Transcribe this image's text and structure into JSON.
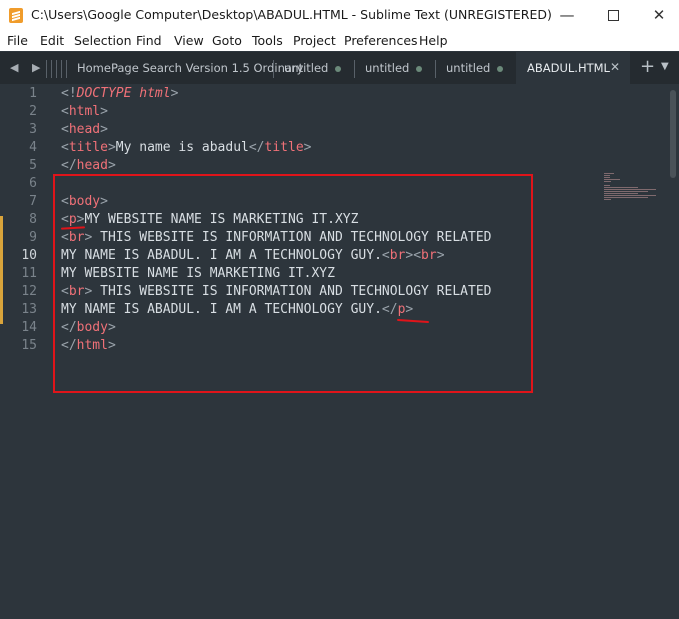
{
  "window": {
    "title": "C:\\Users\\Google Computer\\Desktop\\ABADUL.HTML - Sublime Text (UNREGISTERED)",
    "min_glyph": "—",
    "close_glyph": "✕"
  },
  "menu": [
    "File",
    "Edit",
    "Selection",
    "Find",
    "View",
    "Goto",
    "Tools",
    "Project",
    "Preferences",
    "Help"
  ],
  "tabs": {
    "nav_glyph": "◀ ▶",
    "items": [
      {
        "label": "HomePage Search Version 1.5 Ordinary"
      },
      {
        "label": "untitled"
      },
      {
        "label": "untitled"
      },
      {
        "label": "untitled"
      },
      {
        "label": "ABADUL.HTML",
        "active": true
      }
    ],
    "close_glyph": "✕",
    "plus_glyph": "+",
    "down_glyph": "▼"
  },
  "editor": {
    "active_line": 10,
    "lines": [
      {
        "n": "1",
        "tokens": [
          {
            "t": "punc",
            "v": "<!"
          },
          {
            "t": "doctype",
            "v": "DOCTYPE"
          },
          {
            "t": "text",
            "v": " "
          },
          {
            "t": "doctype",
            "v": "html"
          },
          {
            "t": "punc",
            "v": ">"
          }
        ]
      },
      {
        "n": "2",
        "tokens": [
          {
            "t": "punc",
            "v": "<"
          },
          {
            "t": "tag",
            "v": "html"
          },
          {
            "t": "punc",
            "v": ">"
          }
        ]
      },
      {
        "n": "3",
        "tokens": [
          {
            "t": "punc",
            "v": "<"
          },
          {
            "t": "tag",
            "v": "head"
          },
          {
            "t": "punc",
            "v": ">"
          }
        ]
      },
      {
        "n": "4",
        "tokens": [
          {
            "t": "punc",
            "v": "<"
          },
          {
            "t": "tag",
            "v": "title"
          },
          {
            "t": "punc",
            "v": ">"
          },
          {
            "t": "text",
            "v": "My name is abadul"
          },
          {
            "t": "punc",
            "v": "</"
          },
          {
            "t": "tag",
            "v": "title"
          },
          {
            "t": "punc",
            "v": ">"
          }
        ]
      },
      {
        "n": "5",
        "tokens": [
          {
            "t": "punc",
            "v": "</"
          },
          {
            "t": "tag",
            "v": "head"
          },
          {
            "t": "punc",
            "v": ">"
          }
        ]
      },
      {
        "n": "6",
        "tokens": []
      },
      {
        "n": "7",
        "tokens": [
          {
            "t": "punc",
            "v": "<"
          },
          {
            "t": "tag",
            "v": "body"
          },
          {
            "t": "punc",
            "v": ">"
          }
        ]
      },
      {
        "n": "8",
        "tokens": [
          {
            "t": "punc",
            "v": "<"
          },
          {
            "t": "tag",
            "v": "p"
          },
          {
            "t": "punc",
            "v": ">"
          },
          {
            "t": "text",
            "v": "MY WEBSITE NAME IS MARKETING IT.XYZ"
          }
        ]
      },
      {
        "n": "9",
        "tokens": [
          {
            "t": "punc",
            "v": "<"
          },
          {
            "t": "tag",
            "v": "br"
          },
          {
            "t": "punc",
            "v": ">"
          },
          {
            "t": "text",
            "v": " THIS WEBSITE IS INFORMATION AND TECHNOLOGY RELATED"
          }
        ]
      },
      {
        "n": "10",
        "tokens": [
          {
            "t": "text",
            "v": "MY NAME IS ABADUL. I AM A TECHNOLOGY GUY."
          },
          {
            "t": "punc",
            "v": "<"
          },
          {
            "t": "tag",
            "v": "br"
          },
          {
            "t": "punc",
            "v": ">"
          },
          {
            "t": "punc",
            "v": "<"
          },
          {
            "t": "tag",
            "v": "br"
          },
          {
            "t": "punc",
            "v": ">"
          }
        ]
      },
      {
        "n": "11",
        "tokens": [
          {
            "t": "text",
            "v": "MY WEBSITE NAME IS MARKETING IT.XYZ"
          }
        ]
      },
      {
        "n": "12",
        "tokens": [
          {
            "t": "punc",
            "v": "<"
          },
          {
            "t": "tag",
            "v": "br"
          },
          {
            "t": "punc",
            "v": ">"
          },
          {
            "t": "text",
            "v": " THIS WEBSITE IS INFORMATION AND TECHNOLOGY RELATED"
          }
        ]
      },
      {
        "n": "13",
        "tokens": [
          {
            "t": "text",
            "v": "MY NAME IS ABADUL. I AM A TECHNOLOGY GUY."
          },
          {
            "t": "punc",
            "v": "</"
          },
          {
            "t": "tag",
            "v": "p"
          },
          {
            "t": "punc",
            "v": ">"
          }
        ]
      },
      {
        "n": "14",
        "tokens": [
          {
            "t": "punc",
            "v": "</"
          },
          {
            "t": "tag",
            "v": "body"
          },
          {
            "t": "punc",
            "v": ">"
          }
        ]
      },
      {
        "n": "15",
        "tokens": [
          {
            "t": "punc",
            "v": "</"
          },
          {
            "t": "tag",
            "v": "html"
          },
          {
            "t": "punc",
            "v": ">"
          }
        ]
      }
    ],
    "modified_lines": [
      8,
      9,
      10,
      11,
      12,
      13
    ]
  },
  "colors": {
    "background": "#2d353c",
    "tag": "#f07178",
    "text": "#d8dee3",
    "annotation": "#e0141a",
    "modified_marker": "#d9a43b"
  }
}
